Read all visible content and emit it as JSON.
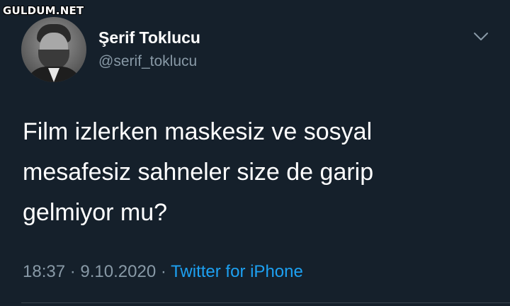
{
  "watermark": "GULDUM.NET",
  "author": {
    "name": "Şerif Toklucu",
    "handle": "@serif_toklucu"
  },
  "tweet": {
    "lines": [
      "Film izlerken maskesiz ve sosyal",
      "mesafesiz sahneler size de garip",
      "gelmiyor mu?"
    ],
    "time": "18:37",
    "separator": " · ",
    "date": "9.10.2020",
    "source": "Twitter for iPhone"
  },
  "icons": {
    "menu": "chevron-down-icon"
  },
  "colors": {
    "background": "#15202b",
    "secondary_text": "#8899a6",
    "link": "#1da1f2"
  }
}
